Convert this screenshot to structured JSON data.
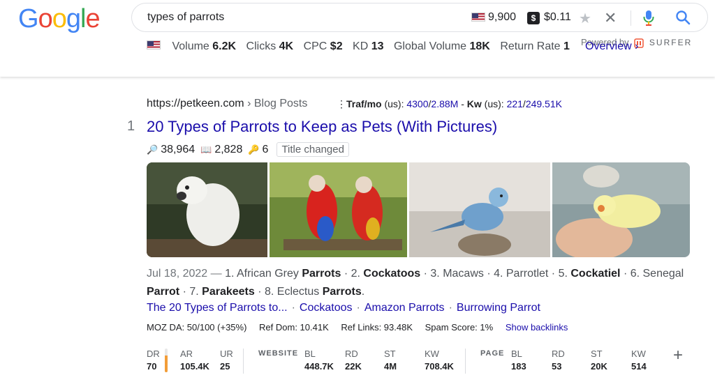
{
  "logo": "Google",
  "logo_letters": [
    {
      "ch": "G",
      "color": "#4285F4"
    },
    {
      "ch": "o",
      "color": "#EA4335"
    },
    {
      "ch": "o",
      "color": "#FBBC05"
    },
    {
      "ch": "g",
      "color": "#4285F4"
    },
    {
      "ch": "l",
      "color": "#34A853"
    },
    {
      "ch": "e",
      "color": "#EA4335"
    }
  ],
  "search": {
    "query": "types of parrots",
    "volume": "9,900",
    "dollar_badge": "$",
    "cpc": "$0.11",
    "star_icon": "star-icon",
    "close_glyph": "✕"
  },
  "metrics": {
    "volume_label": "Volume",
    "volume": "6.2K",
    "clicks_label": "Clicks",
    "clicks": "4K",
    "cpc_label": "CPC",
    "cpc": "$2",
    "kd_label": "KD",
    "kd": "13",
    "global_label": "Global Volume",
    "global": "18K",
    "return_label": "Return Rate",
    "return": "1",
    "overview": "Overview ›",
    "powered_by": "Powered by",
    "surfer": "SURFER"
  },
  "result": {
    "rank": "1",
    "url": "https://petkeen.com",
    "breadcrumb": " › Blog Posts",
    "traf_label": "Traf/mo",
    "traf_us": " (us): ",
    "traf_a": "4300",
    "traf_slash": "/",
    "traf_b": "2.88M",
    "traf_dash": " - ",
    "kw_label": "Kw",
    "kw_us": " (us): ",
    "kw_a": "221",
    "kw_slash": "/",
    "kw_b": "249.51K",
    "title": "20 Types of Parrots to Keep as Pets (With Pictures)",
    "stat_search": "38,964",
    "stat_book": "2,828",
    "stat_key": "6",
    "badge": "Title changed",
    "snippet_date": "Jul 18, 2022 — ",
    "snippet_parts": [
      {
        "t": "1. African Grey ",
        "b": false
      },
      {
        "t": "Parrots",
        "b": true
      },
      {
        "t": " · 2. ",
        "b": false
      },
      {
        "t": "Cockatoos",
        "b": true
      },
      {
        "t": " · 3. Macaws · 4. Parrotlet · 5. ",
        "b": false
      },
      {
        "t": "Cockatiel",
        "b": true
      },
      {
        "t": " · 6. Senegal ",
        "b": false
      },
      {
        "t": "Parrot",
        "b": true
      },
      {
        "t": " · 7. ",
        "b": false
      },
      {
        "t": "Parakeets",
        "b": true
      },
      {
        "t": " · 8. Eclectus ",
        "b": false
      },
      {
        "t": "Parrots",
        "b": true
      },
      {
        "t": ".",
        "b": false
      }
    ],
    "sitelinks": [
      "The 20 Types of Parrots to...",
      "Cockatoos",
      "Amazon Parrots",
      "Burrowing Parrot"
    ],
    "sitelink_sep": "·"
  },
  "moz": {
    "da": "MOZ DA: 50/100 (+35%)",
    "ref_dom": "Ref Dom: 10.41K",
    "ref_links": "Ref Links: 93.48K",
    "spam": "Spam Score: 1%",
    "show_backlinks": "Show backlinks"
  },
  "ahrefs": {
    "dr_label": "DR",
    "dr": "70",
    "dr_fraction": 0.7,
    "ar_label": "AR",
    "ar": "105.4K",
    "ur_label": "UR",
    "ur": "25",
    "website_label": "WEBSITE",
    "w_bl_label": "BL",
    "w_bl": "448.7K",
    "w_rd_label": "RD",
    "w_rd": "22K",
    "w_st_label": "ST",
    "w_st": "4M",
    "w_kw_label": "KW",
    "w_kw": "708.4K",
    "page_label": "PAGE",
    "p_bl_label": "BL",
    "p_bl": "183",
    "p_rd_label": "RD",
    "p_rd": "53",
    "p_st_label": "ST",
    "p_st": "20K",
    "p_kw_label": "KW",
    "p_kw": "514",
    "plus": "+"
  },
  "colors": {
    "link": "#1a0dab",
    "dr_bar": "#f29d38"
  }
}
